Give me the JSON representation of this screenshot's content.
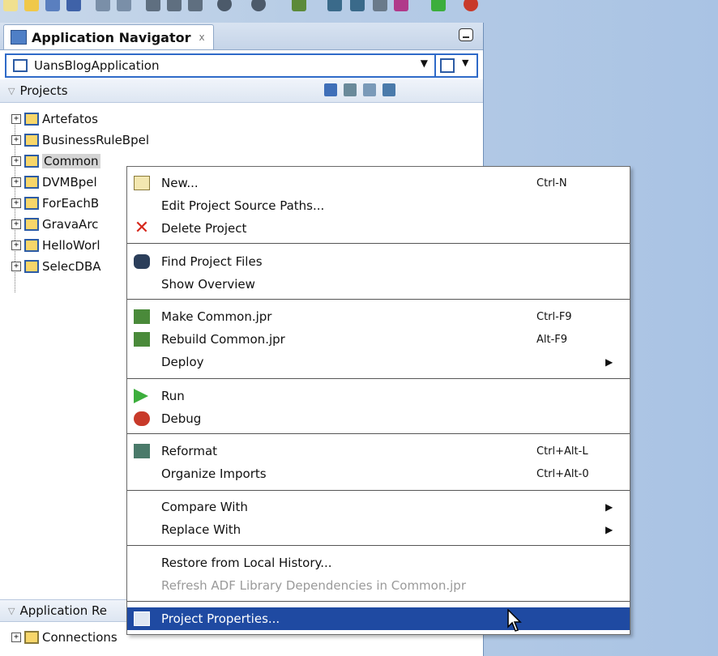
{
  "colors": {
    "menu_highlight": "#1f4aa2",
    "panel_border": "#2f6ac8",
    "folder": "#f7d66a"
  },
  "toolbar": {
    "icons": [
      "new-file-icon",
      "open-folder-icon",
      "save-icon",
      "save-all-icon",
      "undo-icon",
      "redo-icon",
      "cut-icon",
      "copy-icon",
      "paste-icon",
      "back-icon",
      "forward-icon",
      "sql-icon",
      "make-icon",
      "rebuild-icon",
      "deploy-icon",
      "run-icon",
      "debug-icon"
    ]
  },
  "navigator": {
    "tab_title": "Application Navigator",
    "tab_close": "x",
    "application": "UansBlogApplication",
    "projects_label": "Projects",
    "projects": [
      {
        "label": "Artefatos",
        "expander": "+"
      },
      {
        "label": "BusinessRuleBpel",
        "expander": "+"
      },
      {
        "label": "Common",
        "expander": "+"
      },
      {
        "label": "DVMBpel",
        "expander": "+"
      },
      {
        "label": "ForEachB",
        "expander": "+"
      },
      {
        "label": "GravaArc",
        "expander": "+"
      },
      {
        "label": "HelloWorl",
        "expander": "+"
      },
      {
        "label": "SelecDBA",
        "expander": "+"
      }
    ],
    "app_resources_label": "Application Re",
    "resources": [
      {
        "label": "Connections",
        "expander": "+"
      }
    ]
  },
  "context_menu": {
    "items": [
      {
        "label": "New...",
        "shortcut": "Ctrl-N",
        "icon": "new-icon"
      },
      {
        "label": "Edit Project Source Paths...",
        "shortcut": "",
        "icon": ""
      },
      {
        "label": "Delete Project",
        "shortcut": "",
        "icon": "delete-icon"
      },
      {
        "label": "Find Project Files",
        "shortcut": "",
        "icon": "binoculars-icon"
      },
      {
        "label": "Show Overview",
        "shortcut": "",
        "icon": ""
      },
      {
        "label": "Make Common.jpr",
        "shortcut": "Ctrl-F9",
        "icon": "make-icon"
      },
      {
        "label": "Rebuild Common.jpr",
        "shortcut": "Alt-F9",
        "icon": "rebuild-icon"
      },
      {
        "label": "Deploy",
        "shortcut": "",
        "icon": "",
        "submenu": "▶"
      },
      {
        "label": "Run",
        "shortcut": "",
        "icon": "run-icon"
      },
      {
        "label": "Debug",
        "shortcut": "",
        "icon": "debug-icon"
      },
      {
        "label": "Reformat",
        "shortcut": "Ctrl+Alt-L",
        "icon": "reformat-icon"
      },
      {
        "label": "Organize Imports",
        "shortcut": "Ctrl+Alt-0",
        "icon": ""
      },
      {
        "label": "Compare With",
        "shortcut": "",
        "icon": "",
        "submenu": "▶"
      },
      {
        "label": "Replace With",
        "shortcut": "",
        "icon": "",
        "submenu": "▶"
      },
      {
        "label": "Restore from Local History...",
        "shortcut": "",
        "icon": ""
      },
      {
        "label": "Refresh ADF Library Dependencies in Common.jpr",
        "shortcut": "",
        "icon": "",
        "disabled": true
      },
      {
        "label": "Project Properties...",
        "shortcut": "",
        "icon": "properties-icon",
        "highlighted": true
      }
    ]
  }
}
